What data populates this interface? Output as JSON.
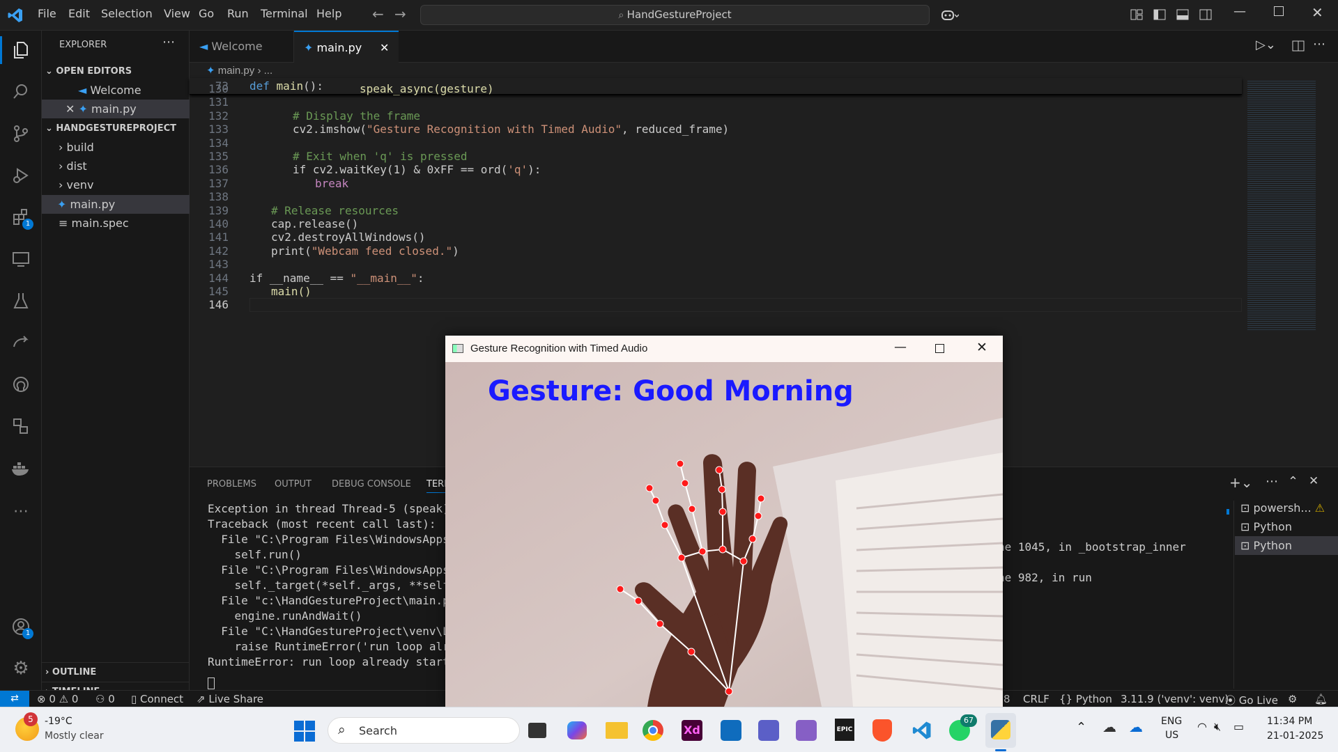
{
  "menu": {
    "file": "File",
    "edit": "Edit",
    "selection": "Selection",
    "view": "View",
    "go": "Go",
    "run": "Run",
    "terminal": "Terminal",
    "help": "Help"
  },
  "search": {
    "text": "HandGestureProject"
  },
  "activity": {
    "extensions_badge": "1",
    "accounts_badge": "1"
  },
  "sidebar": {
    "title": "EXPLORER",
    "open_editors": "OPEN EDITORS",
    "open_items": [
      "Welcome",
      "main.py"
    ],
    "project": "HANDGESTUREPROJECT",
    "items": [
      "build",
      "dist",
      "venv",
      "main.py",
      "main.spec"
    ],
    "outline": "OUTLINE",
    "timeline": "TIMELINE"
  },
  "tabs": {
    "welcome": "Welcome",
    "main": "main.py"
  },
  "breadcrumb": {
    "file": "main.py",
    "rest": "..."
  },
  "editor": {
    "sticky": {
      "ln": "73",
      "code": "def main():"
    },
    "lines": [
      {
        "ln": "130",
        "text": "speak_async(gesture)"
      },
      {
        "ln": "131",
        "text": ""
      },
      {
        "ln": "132",
        "text": "# Display the frame"
      },
      {
        "ln": "133",
        "a": "cv2.imshow(",
        "s": "\"Gesture Recognition with Timed Audio\"",
        "b": ", reduced_frame)"
      },
      {
        "ln": "134",
        "text": ""
      },
      {
        "ln": "135",
        "text": "# Exit when 'q' is pressed"
      },
      {
        "ln": "136",
        "a": "if cv2.waitKey(1) & 0xFF == ord(",
        "s": "'q'",
        "b": "):"
      },
      {
        "ln": "137",
        "text": "break"
      },
      {
        "ln": "138",
        "text": ""
      },
      {
        "ln": "139",
        "text": "# Release resources"
      },
      {
        "ln": "140",
        "text": "cap.release()"
      },
      {
        "ln": "141",
        "text": "cv2.destroyAllWindows()"
      },
      {
        "ln": "142",
        "a": "print(",
        "s": "\"Webcam feed closed.\"",
        "b": ")"
      },
      {
        "ln": "143",
        "text": ""
      },
      {
        "ln": "144",
        "a": "if __name__ == ",
        "s": "\"__main__\"",
        "b": ":"
      },
      {
        "ln": "145",
        "text": "main()"
      },
      {
        "ln": "146",
        "text": ""
      }
    ]
  },
  "panel": {
    "tabs": [
      "PROBLEMS",
      "OUTPUT",
      "DEBUG CONSOLE",
      "TERM"
    ],
    "terminal_lines": [
      "Exception in thread Thread-5 (speak):",
      "Traceback (most recent call last):",
      "  File \"C:\\Program Files\\WindowsApps\\P",
      "    self.run()",
      "  File \"C:\\Program Files\\WindowsApps\\P",
      "    self._target(*self._args, **self._",
      "  File \"c:\\HandGestureProject\\main.py\"",
      "    engine.runAndWait()",
      "  File \"C:\\HandGestureProject\\venv\\Lib",
      "    raise RuntimeError('run loop alrea",
      "RuntimeError: run loop already started"
    ],
    "right_fragments": [
      "ne 1045, in _bootstrap_inner",
      "ne 982, in run"
    ],
    "terminals": [
      "powersh...",
      "Python",
      "Python"
    ]
  },
  "status": {
    "errors": "0",
    "warnings": "0",
    "ports": "0",
    "connect": "Connect",
    "liveshare": "Live Share",
    "spaces_frag": "8",
    "eol": "CRLF",
    "language": "Python",
    "interpreter": "3.11.9 ('venv': venv)",
    "golive": "Go Live"
  },
  "gesture_window": {
    "title": "Gesture Recognition with Timed Audio",
    "overlay_text": "Gesture: Good Morning"
  },
  "taskbar": {
    "weather_badge": "5",
    "temp": "-19°C",
    "weather": "Mostly clear",
    "search": "Search",
    "whatsapp_badge": "67",
    "lang1": "ENG",
    "lang2": "US",
    "time": "11:34 PM",
    "date": "21-01-2025"
  },
  "colors": {
    "accent": "#0078d4",
    "overlay_text": "#1a1aff",
    "landmark": "#ff1a1a"
  }
}
